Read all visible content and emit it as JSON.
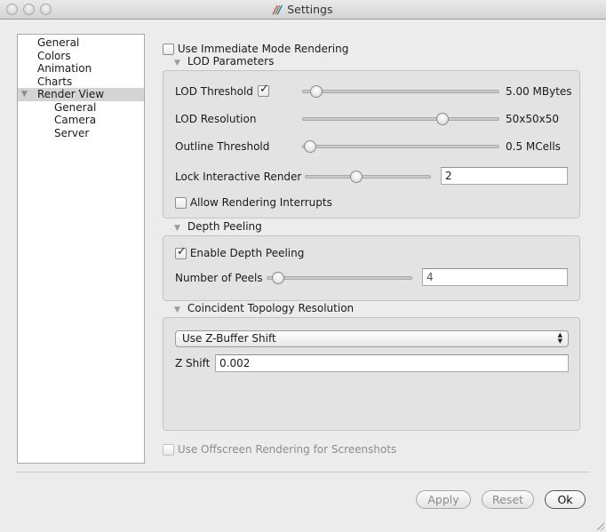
{
  "window": {
    "title": "Settings",
    "title_icon": "paraview-logo-icon",
    "traffic_lights": [
      "close",
      "minimize",
      "zoom"
    ]
  },
  "sidebar": {
    "items": [
      {
        "label": "General",
        "level": 0,
        "selected": false
      },
      {
        "label": "Colors",
        "level": 0,
        "selected": false
      },
      {
        "label": "Animation",
        "level": 0,
        "selected": false
      },
      {
        "label": "Charts",
        "level": 0,
        "selected": false
      },
      {
        "label": "Render View",
        "level": 0,
        "selected": true,
        "expanded": true
      },
      {
        "label": "General",
        "level": 1,
        "selected": false
      },
      {
        "label": "Camera",
        "level": 1,
        "selected": false
      },
      {
        "label": "Server",
        "level": 1,
        "selected": false
      }
    ]
  },
  "main": {
    "immediate_mode": {
      "label": "Use Immediate Mode Rendering",
      "checked": false
    },
    "lod": {
      "title": "LOD Parameters",
      "threshold": {
        "label": "LOD Threshold",
        "checked": true,
        "slider_fraction": 0.07,
        "value_text": "5.00 MBytes"
      },
      "resolution": {
        "label": "LOD Resolution",
        "slider_fraction": 0.71,
        "value_text": "50x50x50"
      },
      "outline": {
        "label": "Outline Threshold",
        "slider_fraction": 0.04,
        "value_text": "0.5 MCells"
      },
      "lock_interactive": {
        "label": "Lock Interactive Render",
        "slider_fraction": 0.41,
        "value": "2"
      },
      "allow_interrupts": {
        "label": "Allow Rendering Interrupts",
        "checked": false
      }
    },
    "depth_peeling": {
      "title": "Depth Peeling",
      "enable": {
        "label": "Enable Depth Peeling",
        "checked": true
      },
      "peels": {
        "label": "Number of Peels",
        "slider_fraction": 0.08,
        "value": "4"
      }
    },
    "coincident": {
      "title": "Coincident Topology Resolution",
      "mode": "Use Z-Buffer Shift",
      "zshift_label": "Z Shift",
      "zshift_value": "0.002"
    },
    "offscreen": {
      "label": "Use Offscreen Rendering for Screenshots",
      "checked": false,
      "enabled": false
    }
  },
  "buttons": {
    "apply": "Apply",
    "reset": "Reset",
    "ok": "Ok"
  }
}
